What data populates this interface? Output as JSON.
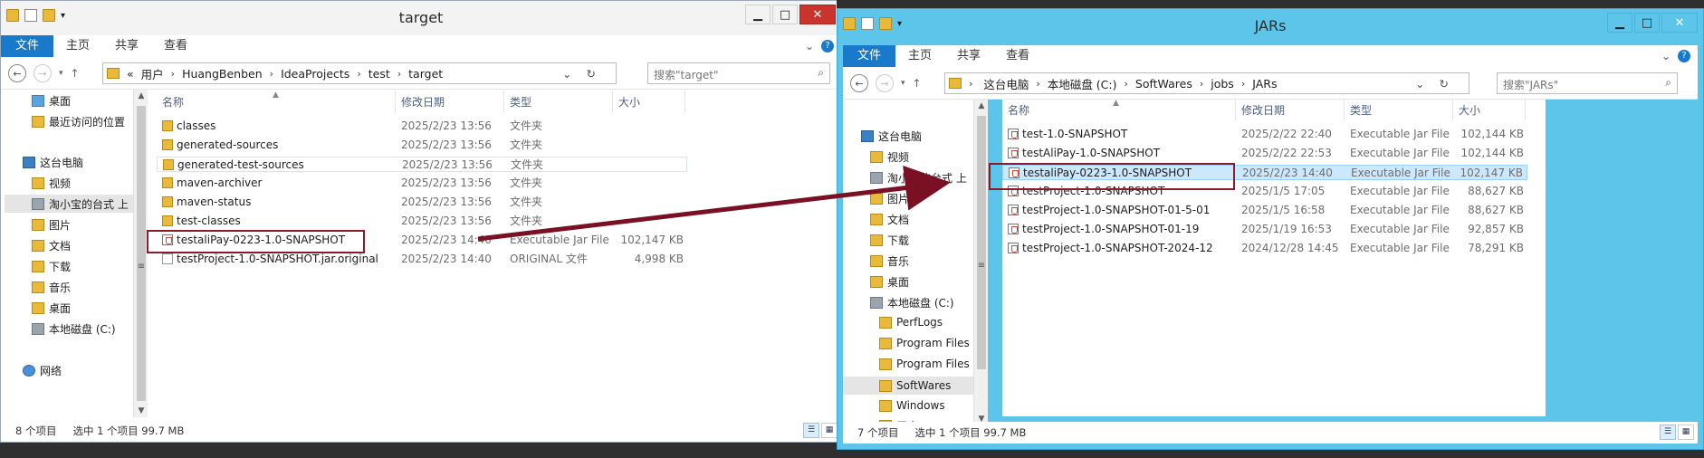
{
  "left": {
    "title": "target",
    "menu": [
      "文件",
      "主页",
      "共享",
      "查看"
    ],
    "path": [
      "«",
      "用户",
      "HuangBenben",
      "IdeaProjects",
      "test",
      "target"
    ],
    "search_placeholder": "搜索\"target\"",
    "nav": [
      {
        "label": "桌面",
        "icon": "desktop-icon"
      },
      {
        "label": "最近访问的位置",
        "icon": "recent-places-icon"
      },
      {
        "label": "这台电脑",
        "icon": "computer-icon"
      },
      {
        "label": "视频",
        "icon": "videos-folder-icon"
      },
      {
        "label": "淘小宝的台式 上",
        "icon": "network-drive-icon"
      },
      {
        "label": "图片",
        "icon": "pictures-folder-icon"
      },
      {
        "label": "文档",
        "icon": "documents-folder-icon"
      },
      {
        "label": "下载",
        "icon": "downloads-folder-icon"
      },
      {
        "label": "音乐",
        "icon": "music-folder-icon"
      },
      {
        "label": "桌面",
        "icon": "desktop-folder-icon"
      },
      {
        "label": "本地磁盘 (C:)",
        "icon": "local-disk-icon"
      },
      {
        "label": "网络",
        "icon": "network-icon"
      }
    ],
    "columns": [
      "名称",
      "修改日期",
      "类型",
      "大小"
    ],
    "files": [
      {
        "name": "classes",
        "date": "2025/2/23 13:56",
        "type": "文件夹",
        "size": "",
        "icon": "folder-icon"
      },
      {
        "name": "generated-sources",
        "date": "2025/2/23 13:56",
        "type": "文件夹",
        "size": "",
        "icon": "folder-icon"
      },
      {
        "name": "generated-test-sources",
        "date": "2025/2/23 13:56",
        "type": "文件夹",
        "size": "",
        "icon": "folder-icon"
      },
      {
        "name": "maven-archiver",
        "date": "2025/2/23 13:56",
        "type": "文件夹",
        "size": "",
        "icon": "folder-icon"
      },
      {
        "name": "maven-status",
        "date": "2025/2/23 13:56",
        "type": "文件夹",
        "size": "",
        "icon": "folder-icon"
      },
      {
        "name": "test-classes",
        "date": "2025/2/23 13:56",
        "type": "文件夹",
        "size": "",
        "icon": "folder-icon"
      },
      {
        "name": "testaliPay-0223-1.0-SNAPSHOT",
        "date": "2025/2/23 14:40",
        "type": "Executable Jar File",
        "size": "102,147 KB",
        "icon": "jar-file-icon"
      },
      {
        "name": "testProject-1.0-SNAPSHOT.jar.original",
        "date": "2025/2/23 14:40",
        "type": "ORIGINAL 文件",
        "size": "4,998 KB",
        "icon": "generic-file-icon"
      }
    ],
    "status": {
      "count": "8 个项目",
      "selected": "选中 1 个项目",
      "size": "99.7 MB"
    }
  },
  "right": {
    "title": "JARs",
    "menu": [
      "文件",
      "主页",
      "共享",
      "查看"
    ],
    "path": [
      "这台电脑",
      "本地磁盘 (C:)",
      "SoftWares",
      "jobs",
      "JARs"
    ],
    "search_placeholder": "搜索\"JARs\"",
    "nav": [
      {
        "label": "这台电脑",
        "icon": "computer-icon"
      },
      {
        "label": "视频",
        "icon": "videos-folder-icon"
      },
      {
        "label": "淘小宝的台式 上",
        "icon": "network-drive-icon"
      },
      {
        "label": "图片",
        "icon": "pictures-folder-icon"
      },
      {
        "label": "文档",
        "icon": "documents-folder-icon"
      },
      {
        "label": "下载",
        "icon": "downloads-folder-icon"
      },
      {
        "label": "音乐",
        "icon": "music-folder-icon"
      },
      {
        "label": "桌面",
        "icon": "desktop-folder-icon"
      },
      {
        "label": "本地磁盘 (C:)",
        "icon": "local-disk-icon"
      },
      {
        "label": "PerfLogs",
        "icon": "folder-icon"
      },
      {
        "label": "Program Files",
        "icon": "folder-icon"
      },
      {
        "label": "Program Files",
        "icon": "folder-icon"
      },
      {
        "label": "SoftWares",
        "icon": "folder-icon"
      },
      {
        "label": "Windows",
        "icon": "folder-icon"
      },
      {
        "label": "用户",
        "icon": "folder-icon"
      }
    ],
    "columns": [
      "名称",
      "修改日期",
      "类型",
      "大小"
    ],
    "files": [
      {
        "name": "test-1.0-SNAPSHOT",
        "date": "2025/2/22 22:40",
        "type": "Executable Jar File",
        "size": "102,144 KB",
        "icon": "jar-file-icon"
      },
      {
        "name": "testAliPay-1.0-SNAPSHOT",
        "date": "2025/2/22 22:53",
        "type": "Executable Jar File",
        "size": "102,144 KB",
        "icon": "jar-file-icon"
      },
      {
        "name": "testaliPay-0223-1.0-SNAPSHOT",
        "date": "2025/2/23 14:40",
        "type": "Executable Jar File",
        "size": "102,147 KB",
        "icon": "jar-file-icon"
      },
      {
        "name": "testProject-1.0-SNAPSHOT",
        "date": "2025/1/5 17:05",
        "type": "Executable Jar File",
        "size": "88,627 KB",
        "icon": "jar-file-icon"
      },
      {
        "name": "testProject-1.0-SNAPSHOT-01-5-01",
        "date": "2025/1/5 16:58",
        "type": "Executable Jar File",
        "size": "88,627 KB",
        "icon": "jar-file-icon"
      },
      {
        "name": "testProject-1.0-SNAPSHOT-01-19",
        "date": "2025/1/19 16:53",
        "type": "Executable Jar File",
        "size": "92,857 KB",
        "icon": "jar-file-icon"
      },
      {
        "name": "testProject-1.0-SNAPSHOT-2024-12",
        "date": "2024/12/28 14:45",
        "type": "Executable Jar File",
        "size": "78,291 KB",
        "icon": "jar-file-icon"
      }
    ],
    "status": {
      "count": "7 个项目",
      "selected": "选中 1 个项目",
      "size": "99.7 MB"
    }
  },
  "colors": {
    "accent": "#1979ca",
    "highlight_box": "#8b1a2a",
    "arrow": "#7a1024",
    "right_frame": "#5ec5ea"
  }
}
